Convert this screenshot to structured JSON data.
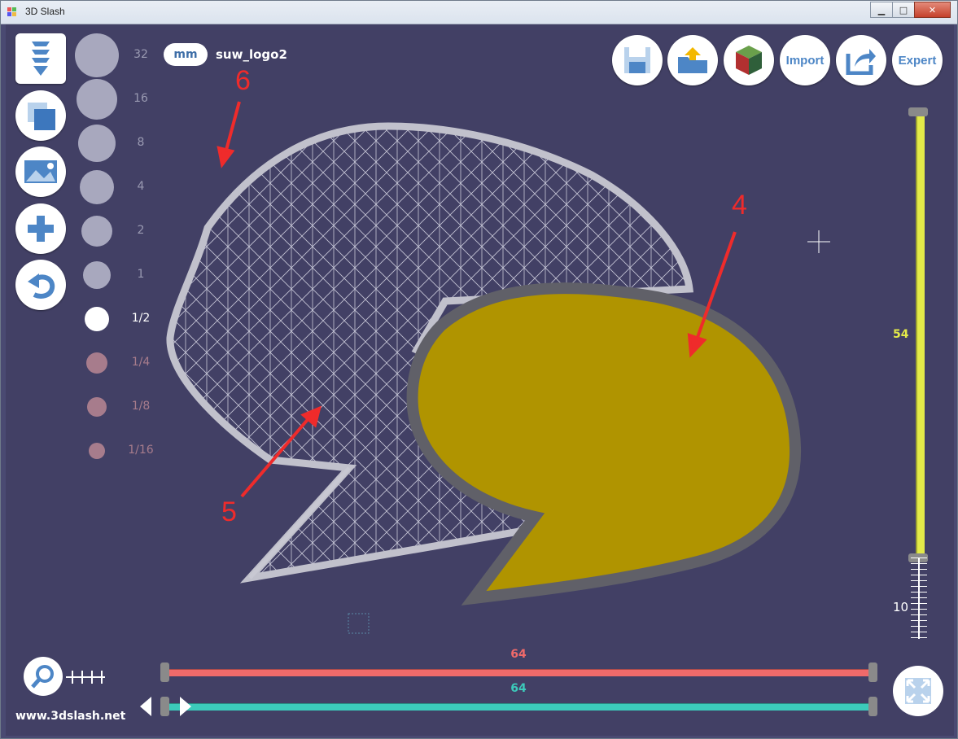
{
  "window": {
    "title": "3D Slash",
    "minimize": "▁",
    "maximize": "□",
    "close": "✕"
  },
  "toolbar_left": [
    {
      "name": "slash-tool",
      "icon": "drill-icon"
    },
    {
      "name": "cube-tool",
      "icon": "cube-icon"
    },
    {
      "name": "image-tool",
      "icon": "image-icon"
    },
    {
      "name": "add-tool",
      "icon": "plus-icon"
    },
    {
      "name": "undo-tool",
      "icon": "undo-icon"
    }
  ],
  "sizes": [
    {
      "label": "32",
      "color": "#a8a8be",
      "selected": false
    },
    {
      "label": "16",
      "color": "#a8a8be",
      "selected": false
    },
    {
      "label": "8",
      "color": "#a8a8be",
      "selected": false
    },
    {
      "label": "4",
      "color": "#a8a8be",
      "selected": false
    },
    {
      "label": "2",
      "color": "#a8a8be",
      "selected": false
    },
    {
      "label": "1",
      "color": "#a8a8be",
      "selected": false
    },
    {
      "label": "1/2",
      "color": "#ffffff",
      "selected": true
    },
    {
      "label": "1/4",
      "color": "#a77c8c",
      "selected": false
    },
    {
      "label": "1/8",
      "color": "#a77c8c",
      "selected": false
    },
    {
      "label": "1/16",
      "color": "#a77c8c",
      "selected": false
    }
  ],
  "unit": "mm",
  "filename": "suw_logo2",
  "top_buttons": {
    "import": "Import",
    "expert": "Expert"
  },
  "vertical_slider": {
    "top_value": "54",
    "bottom_value": "10",
    "color": "#e3ea49"
  },
  "horizontal_sliders": [
    {
      "value": "64",
      "color": "#f06a6a"
    },
    {
      "value": "64",
      "color": "#3ccbbb"
    }
  ],
  "website": "www.3dslash.net",
  "annotations": [
    {
      "label": "4"
    },
    {
      "label": "5"
    },
    {
      "label": "6"
    }
  ]
}
